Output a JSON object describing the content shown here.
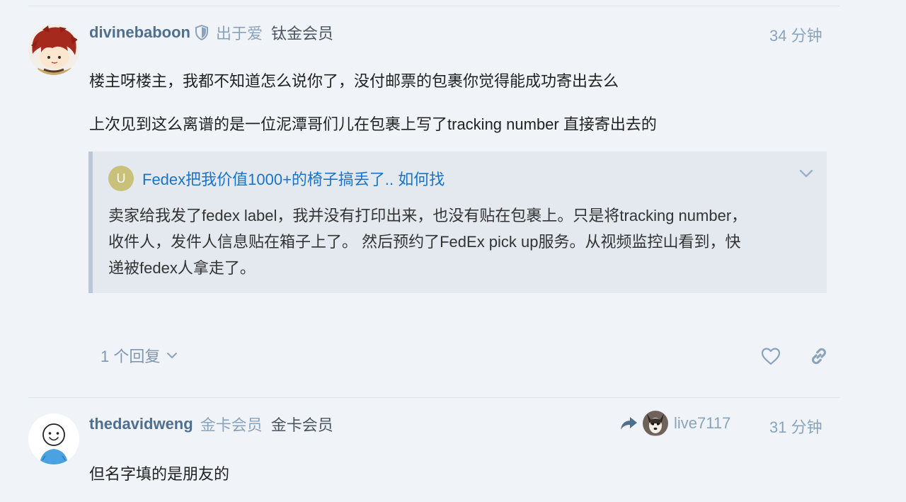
{
  "posts": [
    {
      "username": "divinebaboon",
      "title_1": "出于爱",
      "title_2": "钛金会员",
      "time": "34 分钟",
      "paragraphs": [
        "楼主呀楼主，我都不知道怎么说你了，没付邮票的包裹你觉得能成功寄出去么",
        "上次见到这么离谱的是一位泥潭哥们儿在包裹上写了tracking number 直接寄出去的"
      ],
      "quote": {
        "avatar_letter": "U",
        "title": "Fedex把我价值1000+的椅子搞丢了.. 如何找",
        "lines": [
          "卖家给我发了fedex label，我并没有打印出来，也没有贴在包裹上。只是将tracking number，",
          "收件人，发件人信息贴在箱子上了。 然后预约了FedEx pick up服务。从视频监控山看到，快",
          "递被fedex人拿走了。"
        ]
      },
      "replies_label": "1 个回复"
    },
    {
      "username": "thedavidweng",
      "title_1": "金卡会员",
      "title_2": "金卡会员",
      "time": "31 分钟",
      "reply_to": "live7117",
      "paragraphs": [
        "但名字填的是朋友的"
      ]
    }
  ],
  "icons": {
    "shield": "shield-icon",
    "chevron": "chevron-down-icon",
    "heart": "heart-icon",
    "link": "link-icon",
    "reply_arrow": "reply-arrow-icon"
  }
}
